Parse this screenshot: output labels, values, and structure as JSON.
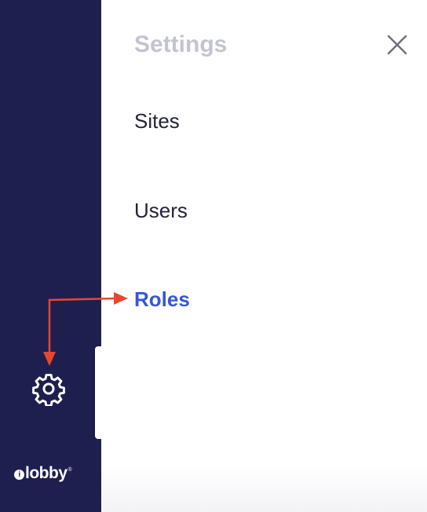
{
  "sidebar": {
    "logo": {
      "mark": "i",
      "text": "lobby",
      "registered": "®"
    },
    "settings_icon": "gear-icon"
  },
  "settings_panel": {
    "title": "Settings",
    "close_icon": "close-icon",
    "items": [
      {
        "label": "Sites"
      },
      {
        "label": "Users"
      },
      {
        "label": "Roles",
        "active": true
      }
    ]
  },
  "annotation": {
    "arrow_color": "#e8472f"
  },
  "colors": {
    "sidebar_bg": "#1f1f4f",
    "accent": "#3657d6",
    "title_muted": "#c4c4cf",
    "item_text": "#23233a"
  }
}
